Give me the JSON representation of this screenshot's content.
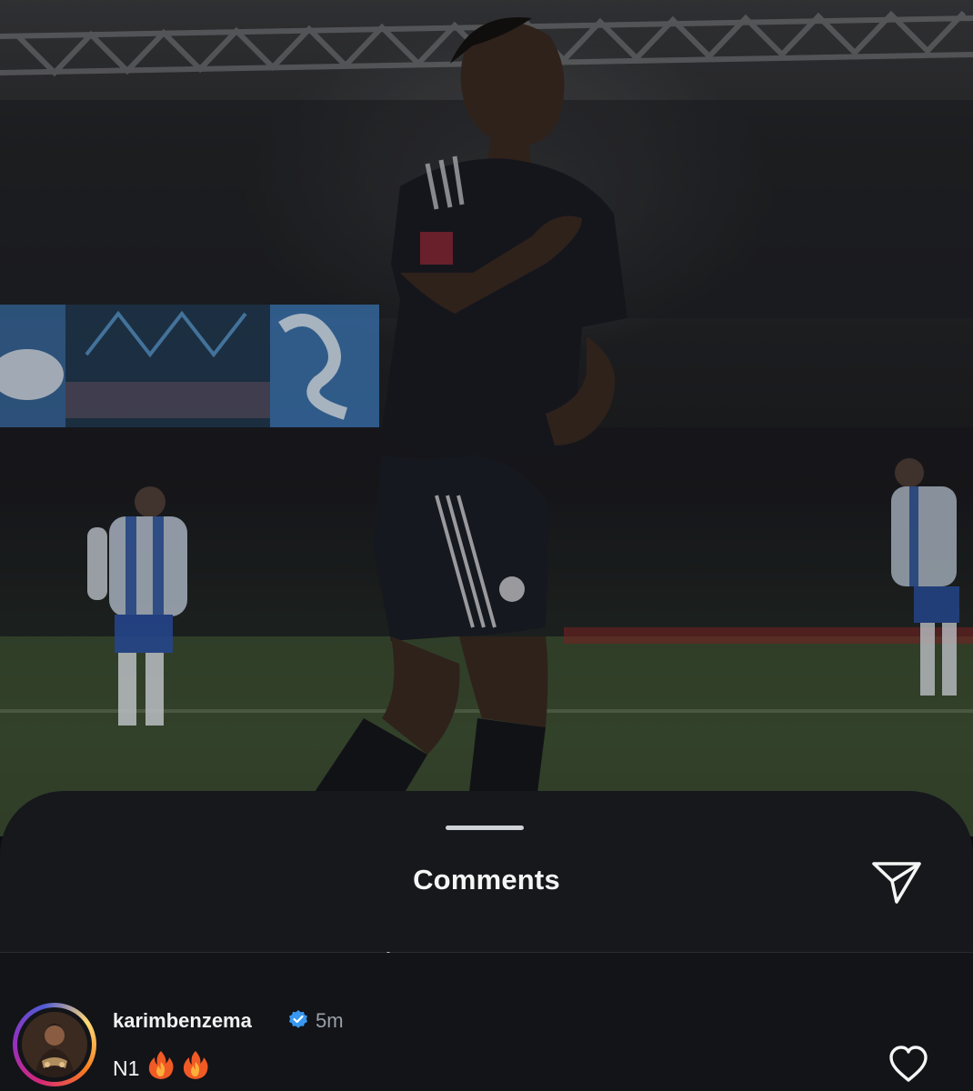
{
  "comments_sheet": {
    "title": "Comments"
  },
  "comments": [
    {
      "username": "karimbenzema",
      "verified": true,
      "timestamp": "5m",
      "text": "N1",
      "emoji": [
        "fire-icon",
        "fire-icon"
      ]
    }
  ],
  "colors": {
    "sheet_background": "#16181c",
    "list_background": "#121418",
    "verified_badge": "#3897f0",
    "story_ring": [
      "#d62976",
      "#962fbf",
      "#4f5bd5",
      "#feda75",
      "#fa7e1e"
    ]
  }
}
